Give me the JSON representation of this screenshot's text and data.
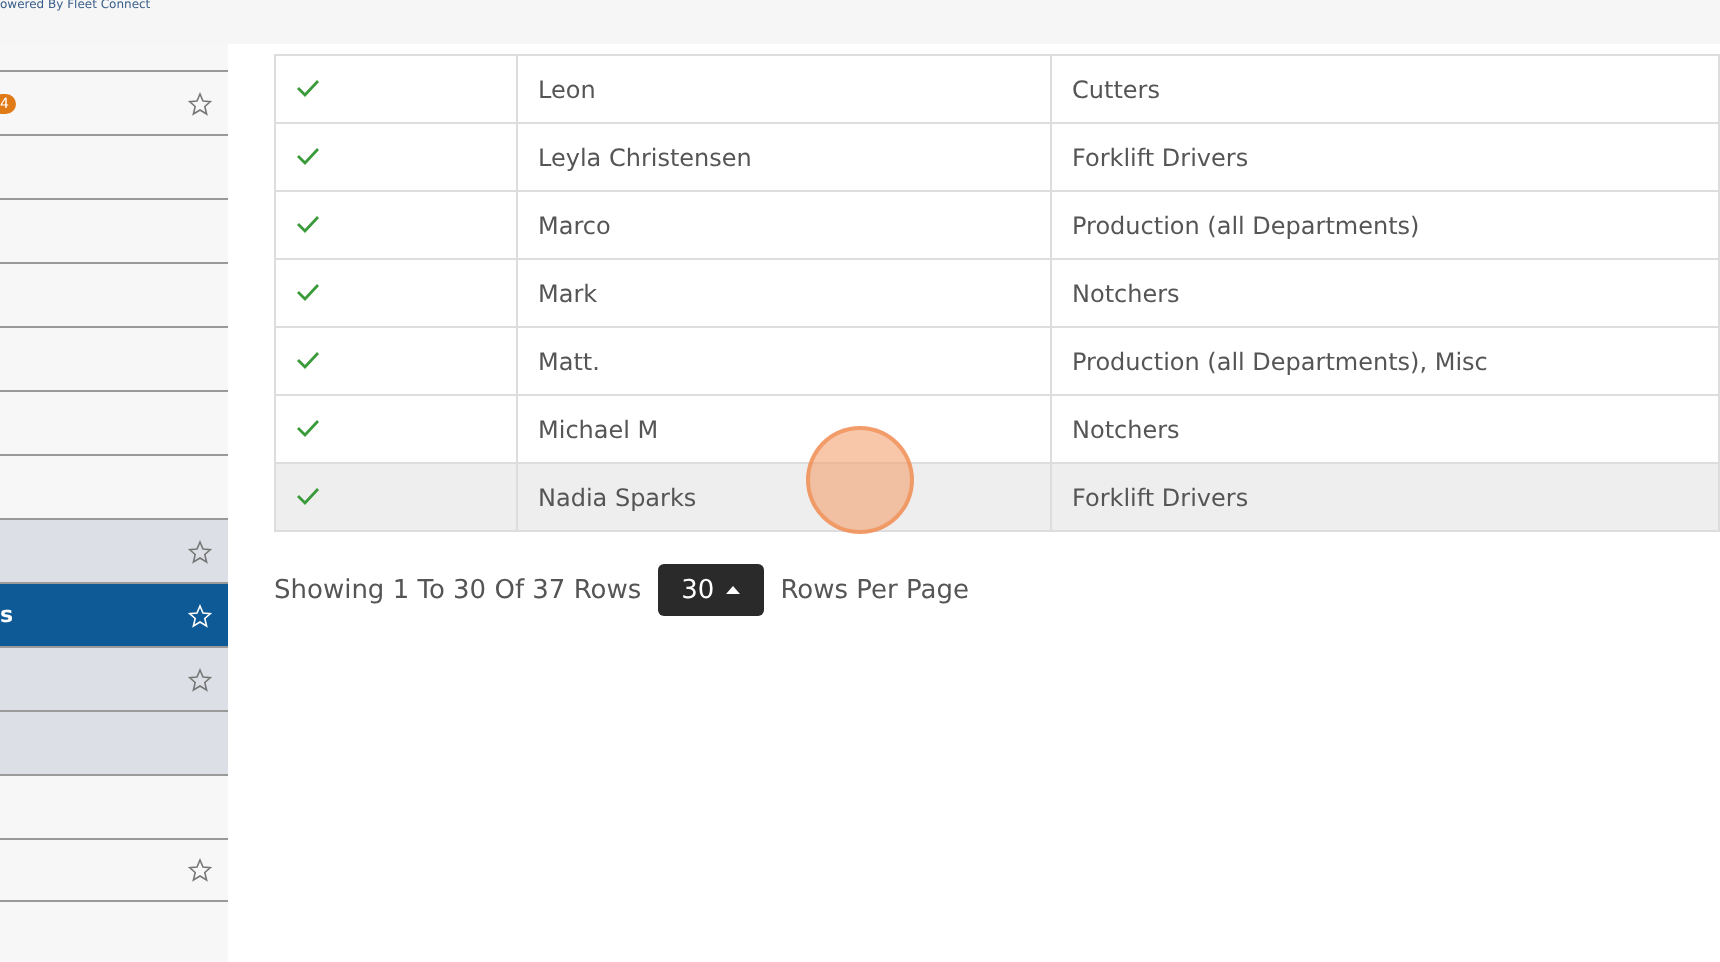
{
  "header": {
    "tagline": "owered By Fleet Connect"
  },
  "sidebar": {
    "items": [
      {
        "badge": "4",
        "starred": true,
        "shaded": false,
        "selected": false
      },
      {
        "starred": false,
        "shaded": false,
        "selected": false
      },
      {
        "starred": false,
        "shaded": false,
        "selected": false
      },
      {
        "starred": false,
        "shaded": false,
        "selected": false
      },
      {
        "starred": false,
        "shaded": false,
        "selected": false
      },
      {
        "starred": false,
        "shaded": false,
        "selected": false
      },
      {
        "starred": false,
        "shaded": false,
        "selected": false
      },
      {
        "starred": true,
        "shaded": true,
        "selected": false
      },
      {
        "label": "s",
        "starred": true,
        "shaded": false,
        "selected": true
      },
      {
        "starred": true,
        "shaded": true,
        "selected": false
      },
      {
        "starred": false,
        "shaded": true,
        "selected": false
      },
      {
        "starred": false,
        "shaded": false,
        "selected": false
      },
      {
        "starred": true,
        "shaded": false,
        "selected": false
      }
    ]
  },
  "table": {
    "rows": [
      {
        "active": true,
        "name": "Leon",
        "groups": "Cutters",
        "hovered": false
      },
      {
        "active": true,
        "name": "Leyla Christensen",
        "groups": "Forklift Drivers",
        "hovered": false
      },
      {
        "active": true,
        "name": "Marco",
        "groups": "Production (all Departments)",
        "hovered": false
      },
      {
        "active": true,
        "name": "Mark",
        "groups": "Notchers",
        "hovered": false
      },
      {
        "active": true,
        "name": "Matt.",
        "groups": "Production (all Departments), Misc",
        "hovered": false
      },
      {
        "active": true,
        "name": "Michael M",
        "groups": "Notchers",
        "hovered": false
      },
      {
        "active": true,
        "name": "Nadia Sparks",
        "groups": "Forklift Drivers",
        "hovered": true
      }
    ]
  },
  "pagination": {
    "summary": "Showing 1 To 30 Of 37 Rows",
    "page_size": "30",
    "suffix": "Rows Per Page"
  }
}
